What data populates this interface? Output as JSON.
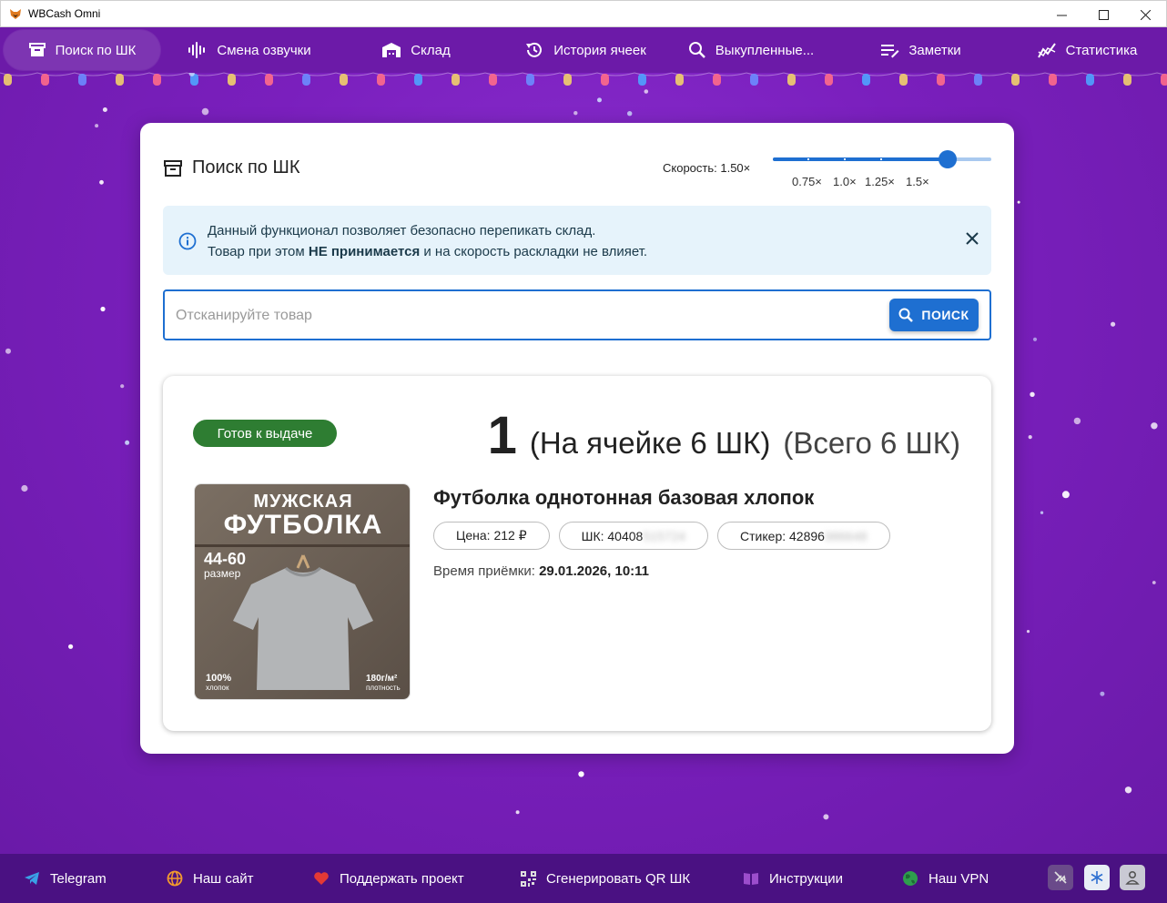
{
  "window": {
    "title": "WBCash Omni",
    "minimize": "—",
    "maximize": "☐",
    "close": "✕"
  },
  "nav": {
    "items": [
      {
        "label": "Поиск по ШК",
        "icon": "archive-icon",
        "active": true
      },
      {
        "label": "Смена озвучки",
        "icon": "waveform-icon"
      },
      {
        "label": "Склад",
        "icon": "warehouse-icon"
      },
      {
        "label": "История ячеек",
        "icon": "history-icon"
      },
      {
        "label": "Выкупленные...",
        "icon": "search-icon"
      },
      {
        "label": "Заметки",
        "icon": "notes-icon"
      },
      {
        "label": "Статистика",
        "icon": "stats-icon"
      }
    ]
  },
  "card": {
    "title": "Поиск по ШК",
    "speed_label": "Скорость: 1.50×",
    "speed_value": 1.5,
    "speed_marks": [
      "0.75×",
      "1.0×",
      "1.25×",
      "1.5×"
    ],
    "info_line1": "Данный функционал позволяет безопасно перепикать склад.",
    "info_line2_prefix": "Товар при этом ",
    "info_line2_bold": "НЕ принимается",
    "info_line2_suffix": " и на скорость раскладки не влияет.",
    "search_placeholder": "Отсканируйте товар",
    "search_button": "ПОИСК"
  },
  "result": {
    "status": "Готов к выдаче",
    "cell_number": "1",
    "on_cell": "(На ячейке 6 ШК)",
    "total": "(Всего 6 ШК)",
    "product_title": "Футболка однотонная базовая хлопок",
    "price_chip": "Цена: 212 ₽",
    "barcode_prefix": "ШК: 40408",
    "barcode_hidden": "515724",
    "sticker_prefix": "Стикер: 42896",
    "sticker_hidden": "986648",
    "accept_label": "Время приёмки: ",
    "accept_time": "29.01.2026, 10:11",
    "image": {
      "line1": "МУЖСКАЯ",
      "line2": "ФУТБОЛКА",
      "size": "44-60",
      "size_label": "размер",
      "cotton": "100%",
      "cotton_label": "хлопок",
      "density": "180г/м²",
      "density_label": "плотность"
    }
  },
  "footer": {
    "items": [
      {
        "label": "Telegram"
      },
      {
        "label": "Наш сайт"
      },
      {
        "label": "Поддержать проект"
      },
      {
        "label": "Сгенерировать QR ШК"
      },
      {
        "label": "Инструкции"
      },
      {
        "label": "Наш VPN"
      }
    ]
  },
  "colors": {
    "accent": "#1e6fd1",
    "background": "#6a1aa8",
    "status_green": "#2e7d32",
    "footer": "#4a1182"
  }
}
